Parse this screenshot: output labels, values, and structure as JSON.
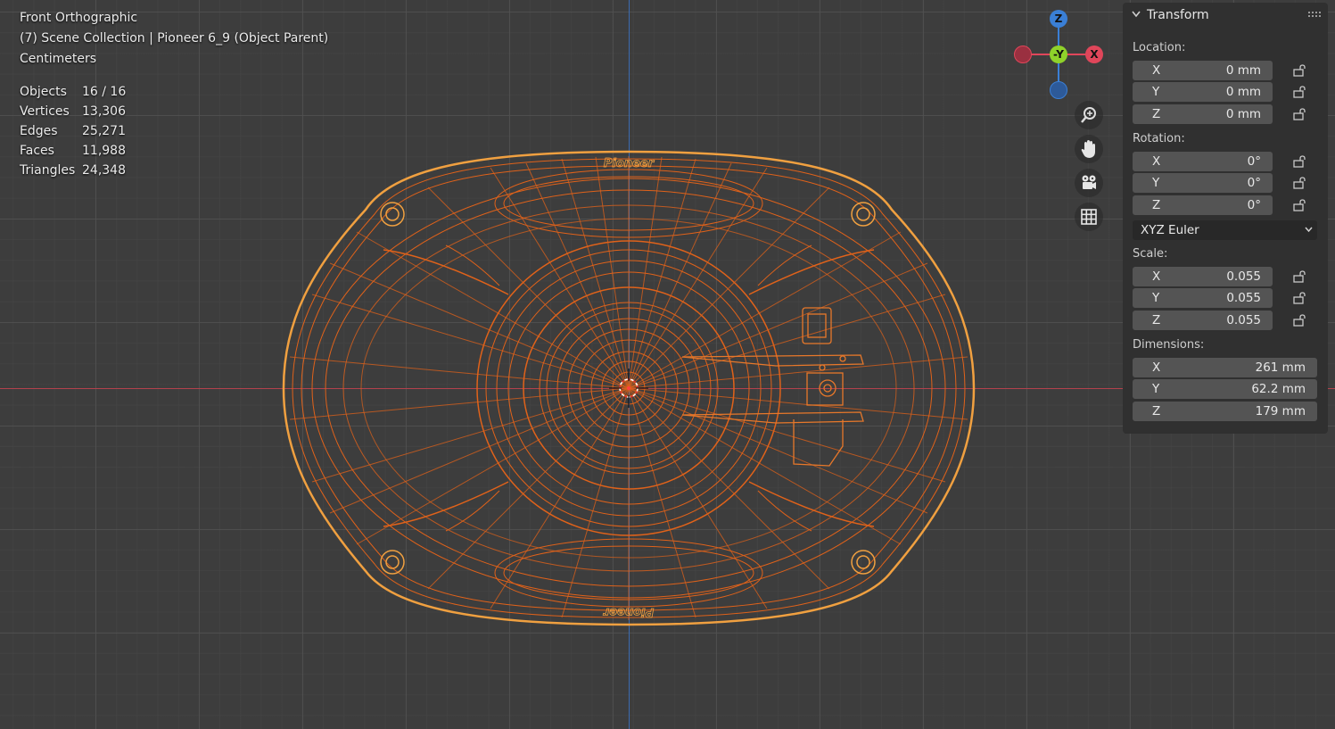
{
  "viewport": {
    "view_name": "Front Orthographic",
    "collection_info": "(7) Scene Collection | Pioneer 6_9 (Object Parent)",
    "units": "Centimeters",
    "stats": [
      {
        "label": "Objects",
        "value": "16 / 16"
      },
      {
        "label": "Vertices",
        "value": "13,306"
      },
      {
        "label": "Edges",
        "value": "25,271"
      },
      {
        "label": "Faces",
        "value": "11,988"
      },
      {
        "label": "Triangles",
        "value": "24,348"
      }
    ],
    "model_logo_text": "Pioneer"
  },
  "gizmo": {
    "z_label": "Z",
    "y_label": "-Y",
    "x_label": "X",
    "colors": {
      "x": "#e0465a",
      "y": "#8fd12a",
      "z": "#3a7fd6"
    }
  },
  "nav_buttons": [
    "zoom-icon",
    "hand-pan-icon",
    "camera-icon",
    "grid-icon"
  ],
  "panel": {
    "title": "Transform",
    "location_label": "Location:",
    "location": {
      "x": "0 mm",
      "y": "0 mm",
      "z": "0 mm"
    },
    "rotation_label": "Rotation:",
    "rotation": {
      "x": "0°",
      "y": "0°",
      "z": "0°"
    },
    "rotation_mode": "XYZ Euler",
    "scale_label": "Scale:",
    "scale": {
      "x": "0.055",
      "y": "0.055",
      "z": "0.055"
    },
    "dimensions_label": "Dimensions:",
    "dimensions": {
      "x": "261 mm",
      "y": "62.2 mm",
      "z": "179 mm"
    },
    "axis_labels": {
      "x": "X",
      "y": "Y",
      "z": "Z"
    }
  },
  "colors": {
    "wire": "#e0621a",
    "wire_light": "#f0a040",
    "panel_bg": "#303030"
  }
}
